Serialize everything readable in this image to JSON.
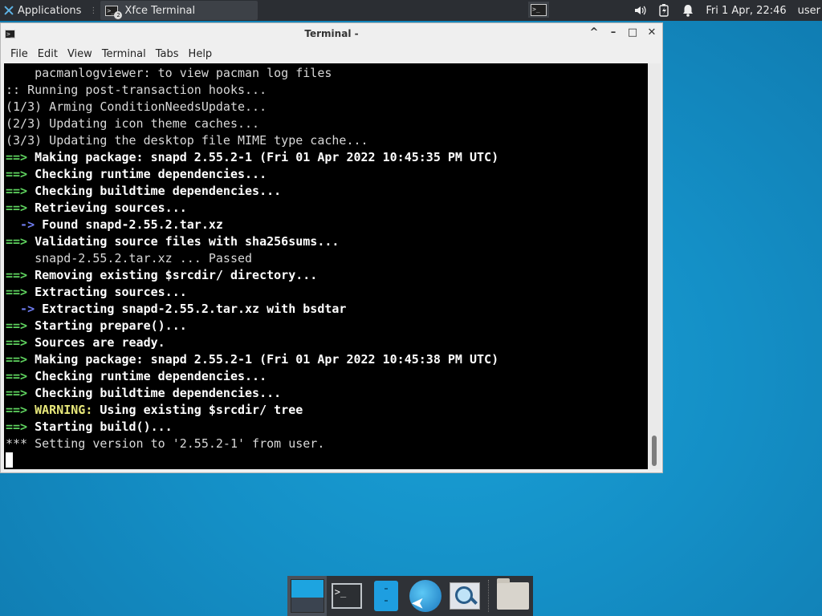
{
  "top_panel": {
    "applications_label": "Applications",
    "task_title": "Xfce Terminal",
    "task_badge": "2",
    "clock": "Fri  1 Apr, 22:46",
    "user": "user"
  },
  "window": {
    "title": "Terminal -",
    "controls": [
      "^",
      "–",
      "□",
      "✕"
    ],
    "menu": [
      "File",
      "Edit",
      "View",
      "Terminal",
      "Tabs",
      "Help"
    ]
  },
  "terminal": {
    "lines": [
      [
        {
          "t": "    pacmanlogviewer: to view pacman log files",
          "c": ""
        }
      ],
      [
        {
          "t": ":: Running post-transaction hooks...",
          "c": ""
        }
      ],
      [
        {
          "t": "(1/3) Arming ConditionNeedsUpdate...",
          "c": ""
        }
      ],
      [
        {
          "t": "(2/3) Updating icon theme caches...",
          "c": ""
        }
      ],
      [
        {
          "t": "(3/3) Updating the desktop file MIME type cache...",
          "c": ""
        }
      ],
      [
        {
          "t": "==> ",
          "c": "g"
        },
        {
          "t": "Making package: snapd 2.55.2-1 (Fri 01 Apr 2022 10:45:35 PM UTC)",
          "c": "w"
        }
      ],
      [
        {
          "t": "==> ",
          "c": "g"
        },
        {
          "t": "Checking runtime dependencies...",
          "c": "w"
        }
      ],
      [
        {
          "t": "==> ",
          "c": "g"
        },
        {
          "t": "Checking buildtime dependencies...",
          "c": "w"
        }
      ],
      [
        {
          "t": "==> ",
          "c": "g"
        },
        {
          "t": "Retrieving sources...",
          "c": "w"
        }
      ],
      [
        {
          "t": "  -> ",
          "c": "b"
        },
        {
          "t": "Found snapd-2.55.2.tar.xz",
          "c": "w"
        }
      ],
      [
        {
          "t": "==> ",
          "c": "g"
        },
        {
          "t": "Validating source files with sha256sums...",
          "c": "w"
        }
      ],
      [
        {
          "t": "    snapd-2.55.2.tar.xz ... Passed",
          "c": ""
        }
      ],
      [
        {
          "t": "==> ",
          "c": "g"
        },
        {
          "t": "Removing existing $srcdir/ directory...",
          "c": "w"
        }
      ],
      [
        {
          "t": "==> ",
          "c": "g"
        },
        {
          "t": "Extracting sources...",
          "c": "w"
        }
      ],
      [
        {
          "t": "  -> ",
          "c": "b"
        },
        {
          "t": "Extracting snapd-2.55.2.tar.xz with bsdtar",
          "c": "w"
        }
      ],
      [
        {
          "t": "==> ",
          "c": "g"
        },
        {
          "t": "Starting prepare()...",
          "c": "w"
        }
      ],
      [
        {
          "t": "==> ",
          "c": "g"
        },
        {
          "t": "Sources are ready.",
          "c": "w"
        }
      ],
      [
        {
          "t": "==> ",
          "c": "g"
        },
        {
          "t": "Making package: snapd 2.55.2-1 (Fri 01 Apr 2022 10:45:38 PM UTC)",
          "c": "w"
        }
      ],
      [
        {
          "t": "==> ",
          "c": "g"
        },
        {
          "t": "Checking runtime dependencies...",
          "c": "w"
        }
      ],
      [
        {
          "t": "==> ",
          "c": "g"
        },
        {
          "t": "Checking buildtime dependencies...",
          "c": "w"
        }
      ],
      [
        {
          "t": "==> ",
          "c": "g"
        },
        {
          "t": "WARNING:",
          "c": "y"
        },
        {
          "t": " Using existing $srcdir/ tree",
          "c": "w"
        }
      ],
      [
        {
          "t": "==> ",
          "c": "g"
        },
        {
          "t": "Starting build()...",
          "c": "w"
        }
      ],
      [
        {
          "t": "*** Setting version to '2.55.2-1' from user.",
          "c": ""
        }
      ]
    ]
  },
  "dock": {
    "items": [
      "desktop",
      "terminal",
      "file-manager",
      "web-browser",
      "app-finder",
      "folder"
    ]
  }
}
